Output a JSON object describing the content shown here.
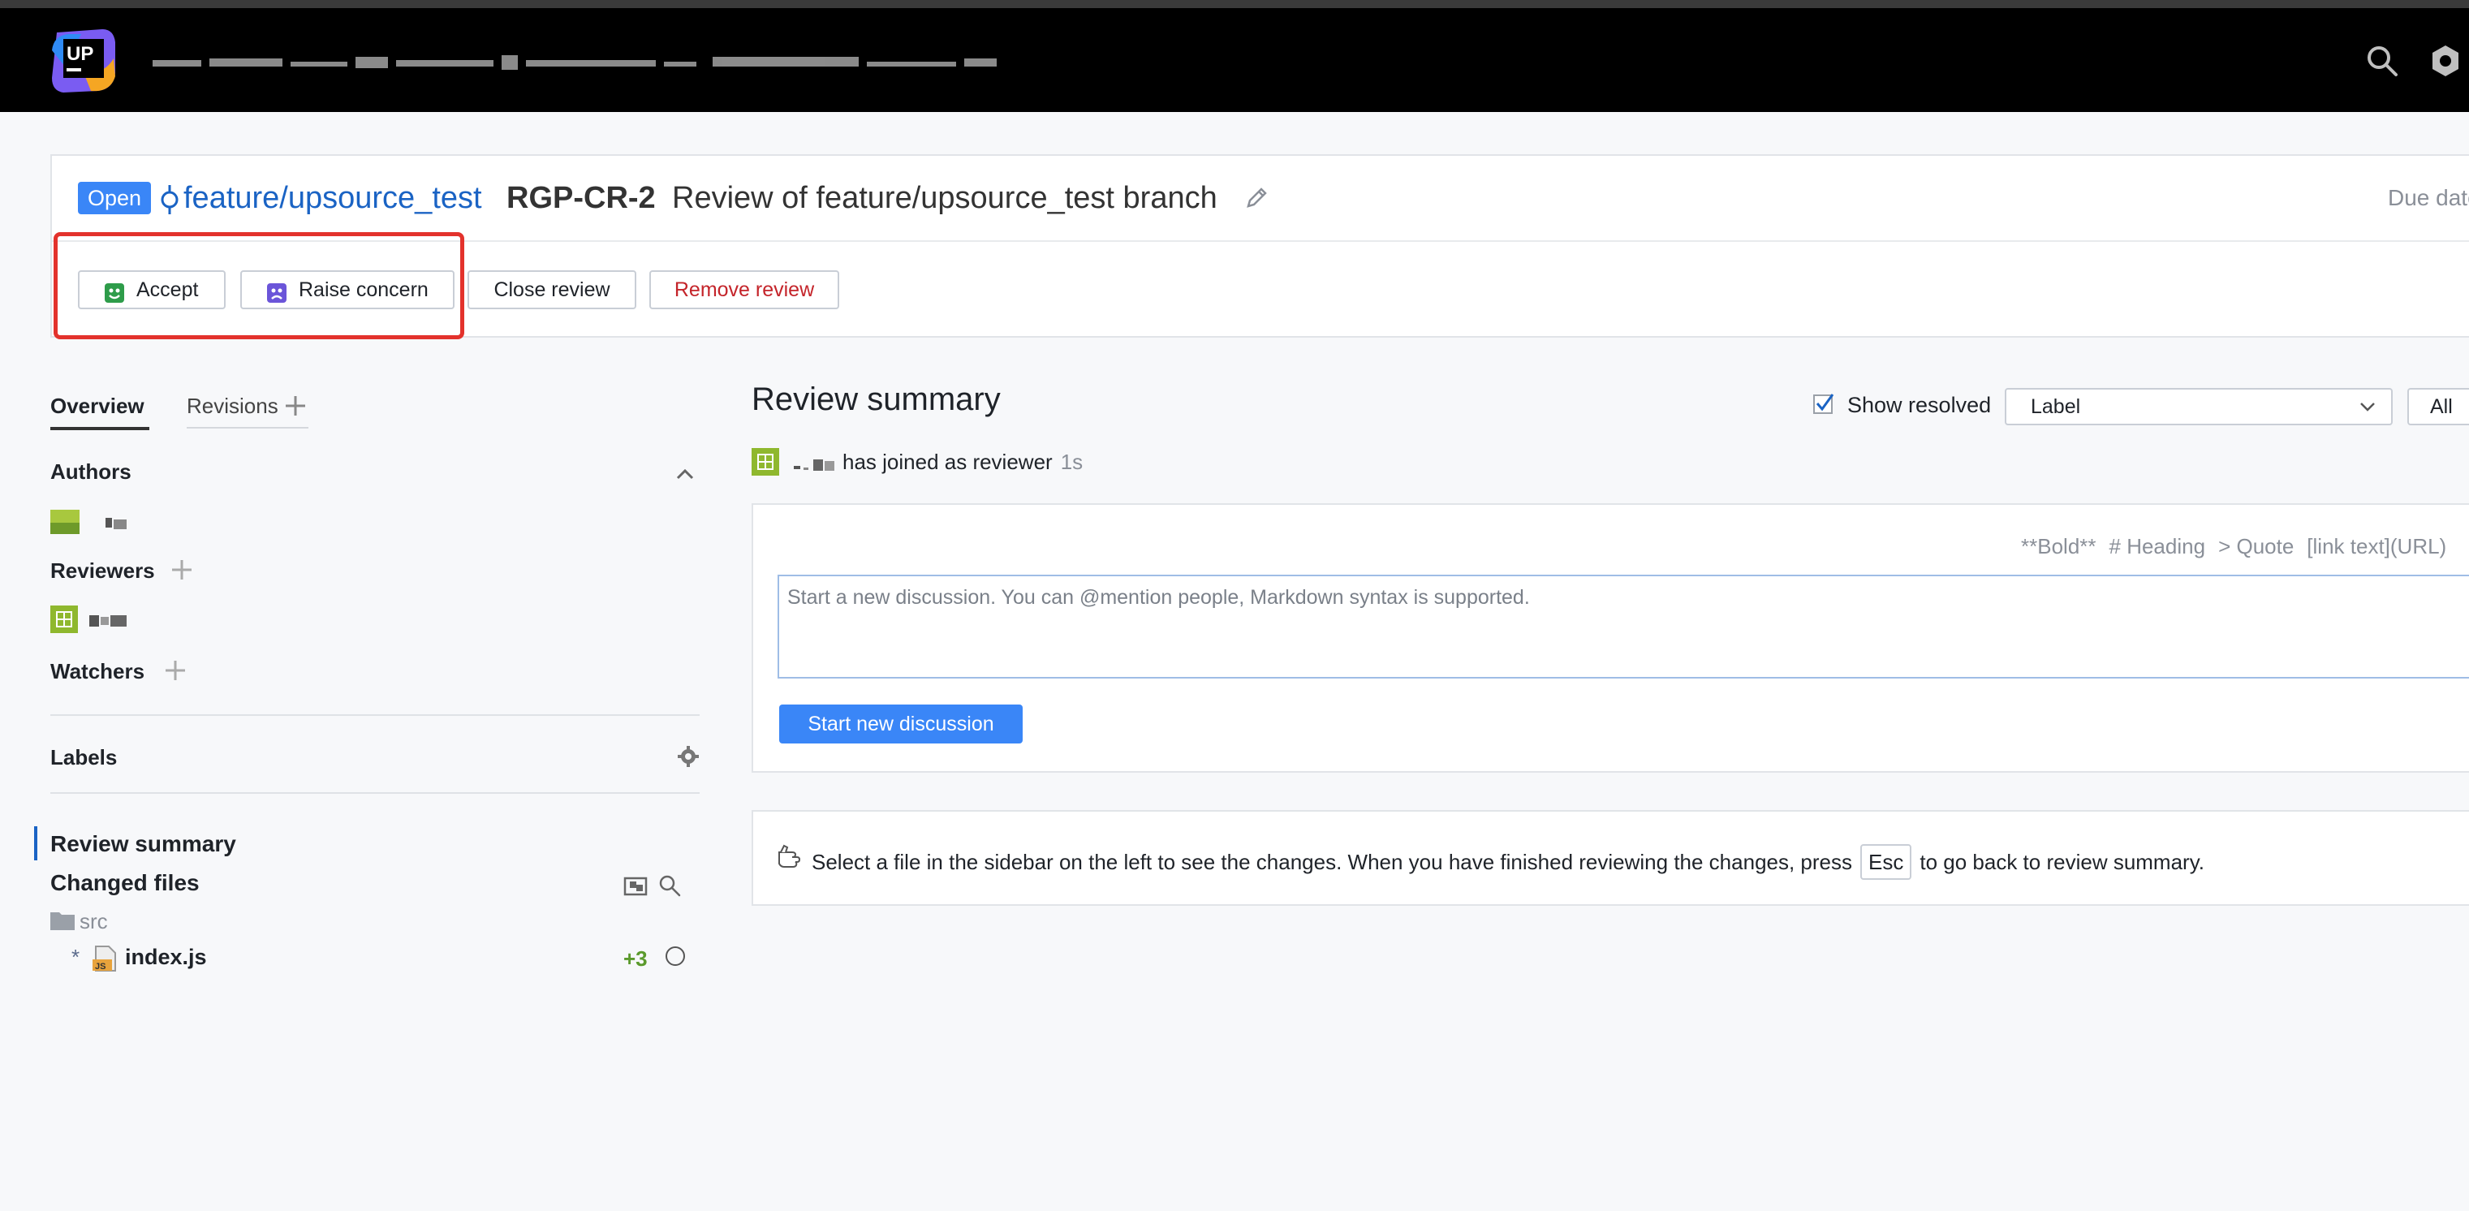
{
  "header": {
    "search_icon": "search-icon",
    "settings_icon": "settings-icon"
  },
  "review": {
    "status": "Open",
    "branch": "feature/upsource_test",
    "id": "RGP-CR-2",
    "title": "Review of feature/upsource_test branch",
    "due_date_label": "Due date"
  },
  "actions": {
    "accept": "Accept",
    "raise_concern": "Raise concern",
    "close_review": "Close review",
    "remove_review": "Remove review"
  },
  "sidebar": {
    "tabs": [
      "Overview",
      "Revisions"
    ],
    "authors_heading": "Authors",
    "reviewers_heading": "Reviewers",
    "watchers_heading": "Watchers",
    "labels_heading": "Labels",
    "nav_summary": "Review summary",
    "changed_files": "Changed files",
    "folder": "src",
    "modified_mark": "*",
    "file": {
      "name": "index.js",
      "diff": "+3"
    }
  },
  "main": {
    "title": "Review summary",
    "show_resolved": "Show resolved",
    "label_select": "Label",
    "all_button": "All",
    "event": {
      "text": "has joined as reviewer",
      "time": "1s"
    },
    "markdown_hints": [
      "**Bold**",
      "# Heading",
      "> Quote",
      "[link text](URL)"
    ],
    "discussion_placeholder": "Start a new discussion. You can @mention people, Markdown syntax is supported.",
    "start_button": "Start new discussion",
    "info_before": "Select a file in the sidebar on the left to see the changes. When you have finished reviewing the changes, press",
    "info_key": "Esc",
    "info_after": "to go back to review summary."
  },
  "colors": {
    "accent": "#3a86f7",
    "link": "#1a63c4",
    "danger": "#c4242a",
    "highlight": "#e3322c",
    "added": "#5b9a2c"
  }
}
